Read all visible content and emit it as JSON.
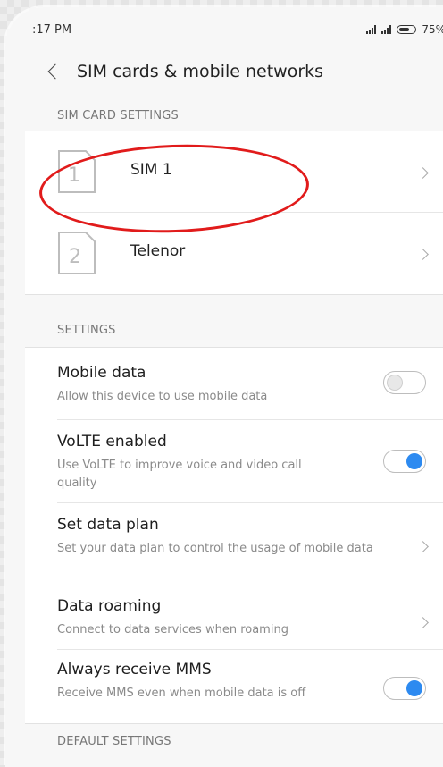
{
  "status_bar": {
    "time": ":17 PM",
    "battery_level": "75%",
    "battery_fraction": 0.75
  },
  "header": {
    "title": "SIM cards & mobile networks",
    "back_icon": "chevron-left-icon"
  },
  "sim_section": {
    "label": "SIM CARD SETTINGS",
    "sims": [
      {
        "number": "1",
        "label": "SIM 1"
      },
      {
        "number": "2",
        "label": "Telenor"
      }
    ]
  },
  "settings_section": {
    "label": "SETTINGS",
    "items": [
      {
        "title": "Mobile data",
        "subtitle": "Allow this device to use mobile data",
        "control": "toggle",
        "enabled": false
      },
      {
        "title": "VoLTE enabled",
        "subtitle": "Use VoLTE to improve voice and video call quality",
        "control": "toggle",
        "enabled": true
      },
      {
        "title": "Set data plan",
        "subtitle": "Set your data plan to control the usage of mobile data",
        "control": "chevron"
      },
      {
        "title": "Data roaming",
        "subtitle": "Connect to data services when roaming",
        "control": "chevron"
      },
      {
        "title": "Always receive MMS",
        "subtitle": "Receive MMS even when mobile data is off",
        "control": "toggle",
        "enabled": true
      }
    ]
  },
  "default_section": {
    "label": "DEFAULT SETTINGS"
  },
  "colors": {
    "accent": "#2d8af0",
    "annotation": "#e11b1b"
  }
}
